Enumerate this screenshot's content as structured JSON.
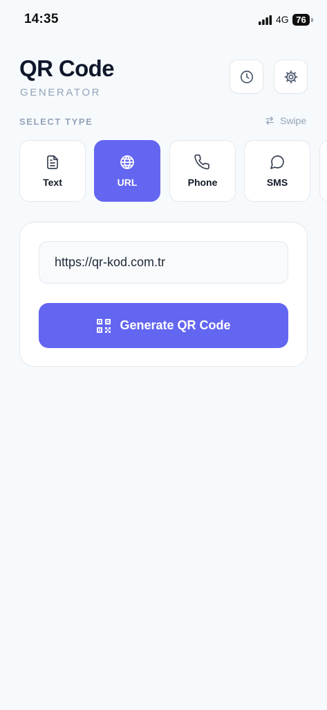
{
  "status_bar": {
    "time": "14:35",
    "network": "4G",
    "battery": "76"
  },
  "header": {
    "title": "QR Code",
    "subtitle": "GENERATOR",
    "history_icon": "clock-icon",
    "settings_icon": "gear-icon"
  },
  "type_selector": {
    "label": "SELECT TYPE",
    "swipe_hint": "Swipe",
    "tabs": [
      {
        "label": "Text",
        "icon": "document-icon",
        "active": false
      },
      {
        "label": "URL",
        "icon": "globe-icon",
        "active": true
      },
      {
        "label": "Phone",
        "icon": "phone-icon",
        "active": false
      },
      {
        "label": "SMS",
        "icon": "chat-bubble-icon",
        "active": false
      }
    ]
  },
  "form": {
    "url_value": "https://qr-kod.com.tr",
    "generate_label": "Generate QR Code"
  },
  "colors": {
    "accent": "#6366f1",
    "background": "#f7fafc",
    "muted_text": "#94a3b8"
  }
}
